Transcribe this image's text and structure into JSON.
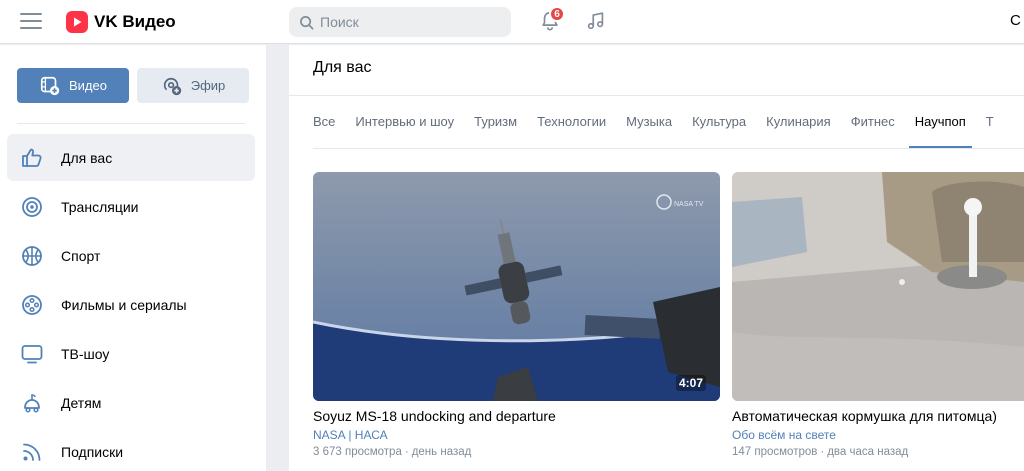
{
  "header": {
    "logo_text": "VK Видео",
    "search_placeholder": "Поиск",
    "notifications_count": "6",
    "cut_text": "С"
  },
  "sidebar": {
    "primary_buttons": [
      {
        "label": "Видео",
        "icon": "video-gallery-icon"
      },
      {
        "label": "Эфир",
        "icon": "live-broadcast-icon"
      }
    ],
    "items": [
      {
        "label": "Для вас",
        "icon": "thumbs-up-icon",
        "active": true
      },
      {
        "label": "Трансляции",
        "icon": "broadcast-target-icon"
      },
      {
        "label": "Спорт",
        "icon": "basketball-icon"
      },
      {
        "label": "Фильмы и сериалы",
        "icon": "film-reel-icon"
      },
      {
        "label": "ТВ-шоу",
        "icon": "tv-icon"
      },
      {
        "label": "Детям",
        "icon": "kids-icon"
      },
      {
        "label": "Подписки",
        "icon": "rss-icon"
      }
    ]
  },
  "main": {
    "title": "Для вас",
    "tabs": [
      "Все",
      "Интервью и шоу",
      "Туризм",
      "Технологии",
      "Музыка",
      "Культура",
      "Кулинария",
      "Фитнес",
      "Научпоп",
      "Т"
    ],
    "active_tab": "Научпоп",
    "videos": [
      {
        "title": "Soyuz MS-18 undocking and departure",
        "channel": "NASA | НАСА",
        "views": "3 673 просмотра",
        "age": "день назад",
        "duration": "4:07",
        "watermark": "NASA TV"
      },
      {
        "title": "Автоматическая кормушка для питомца)",
        "channel": "Обо всём на свете",
        "views": "147 просмотров",
        "age": "два часа назад"
      }
    ]
  },
  "colors": {
    "accent": "#5181b8",
    "brand_red": "#ff3347",
    "badge_red": "#e64646",
    "background": "#ebedf0"
  }
}
